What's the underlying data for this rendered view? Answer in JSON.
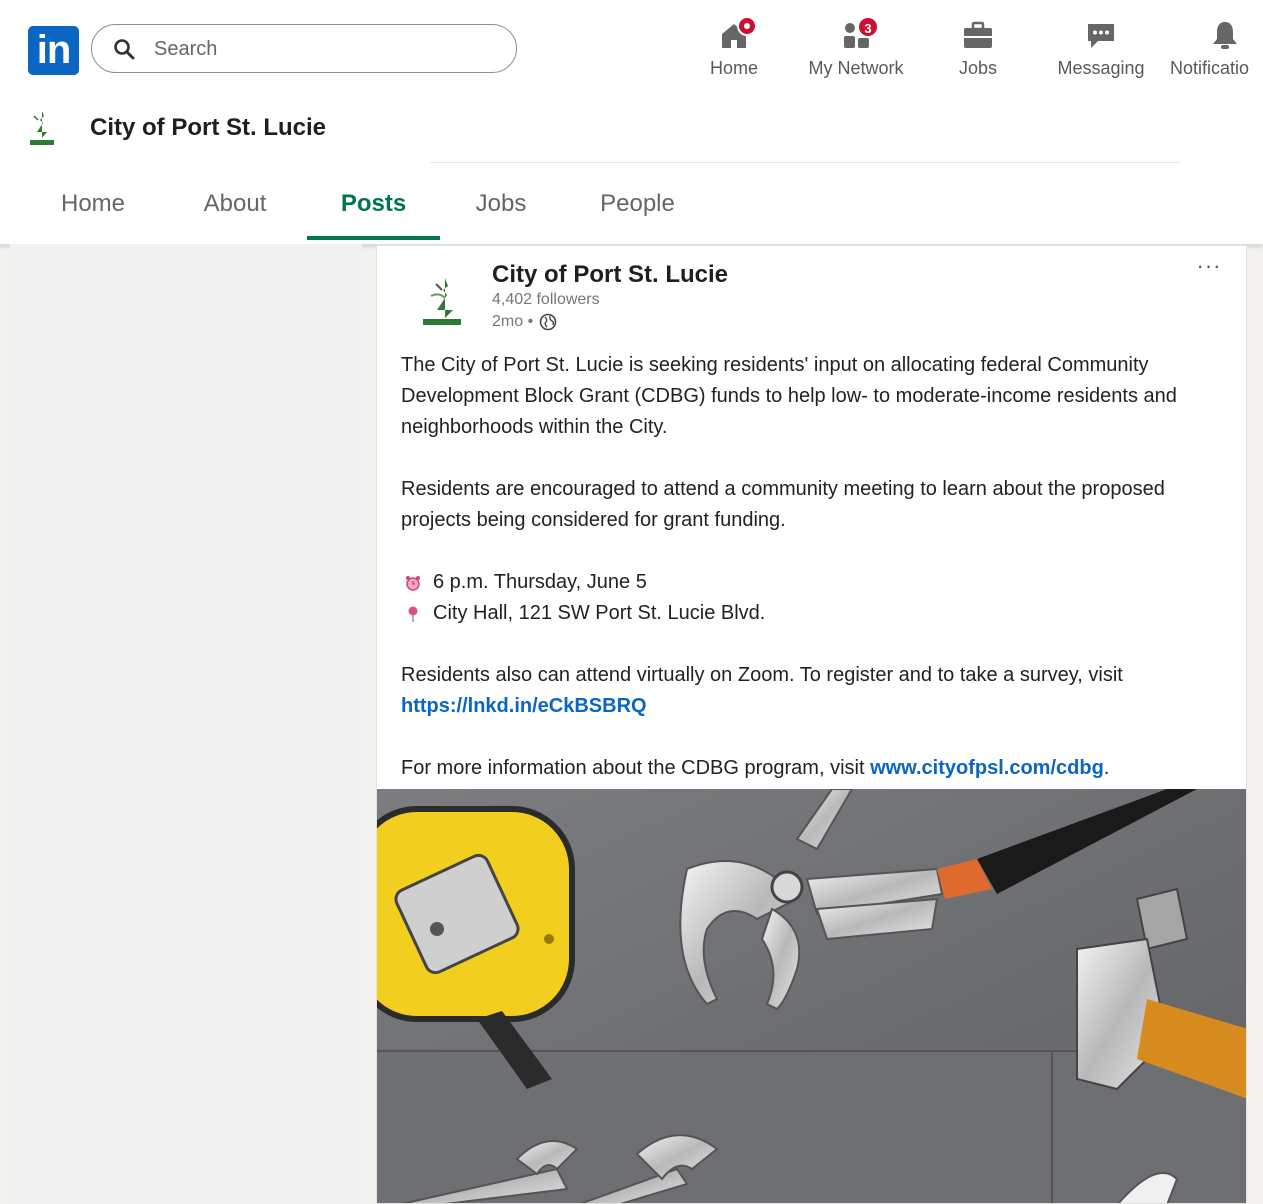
{
  "global_nav": {
    "logo_text": "in",
    "search": {
      "placeholder": "Search",
      "value": ""
    },
    "items": [
      {
        "label": "Home",
        "icon": "home-icon",
        "badge": ""
      },
      {
        "label": "My Network",
        "icon": "people-icon",
        "badge": "3"
      },
      {
        "label": "Jobs",
        "icon": "briefcase-icon",
        "badge": ""
      },
      {
        "label": "Messaging",
        "icon": "chat-icon",
        "badge": ""
      },
      {
        "label": "Notificatio",
        "icon": "bell-icon",
        "badge": ""
      }
    ]
  },
  "company": {
    "name": "City of Port St. Lucie",
    "tabs": [
      {
        "label": "Home",
        "active": false
      },
      {
        "label": "About",
        "active": false
      },
      {
        "label": "Posts",
        "active": true
      },
      {
        "label": "Jobs",
        "active": false
      },
      {
        "label": "People",
        "active": false
      }
    ]
  },
  "post": {
    "author": "City of Port St. Lucie",
    "followers": "4,402 followers",
    "time": "2mo •",
    "more": "···",
    "p1": "The City of Port St. Lucie is seeking residents' input on allocating federal Community Development Block Grant (CDBG) funds to help low- to moderate-income residents and neighborhoods within the City.",
    "p2": "Residents are encouraged to attend a community meeting to learn about the proposed projects being considered for grant funding.",
    "time_line": "6 p.m. Thursday, June 5",
    "place_line": "City Hall, 121 SW Port St. Lucie Blvd.",
    "p3_text": "Residents also can attend virtually on Zoom. To register and to take a survey, visit ",
    "p3_link": "https://lnkd.in/eCkBSBRQ",
    "p4_text": "For more information about the CDBG program, visit ",
    "p4_link": "www.cityofpsl.com/cdbg",
    "p4_end": ".",
    "image_alt": "tools-photo"
  },
  "colors": {
    "brand": "#0a66c2",
    "active_tab": "#01754f",
    "badge": "#cb112d"
  }
}
